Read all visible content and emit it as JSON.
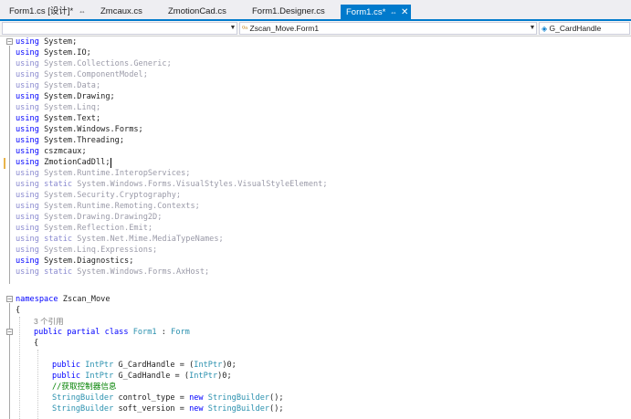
{
  "tabs": [
    {
      "label": "Form1.cs [设计]*",
      "pin": "⇔"
    },
    {
      "label": "Zmcaux.cs"
    },
    {
      "label": "ZmotionCad.cs"
    },
    {
      "label": "Form1.Designer.cs"
    },
    {
      "label": "Form1.cs*",
      "pin": "⇔",
      "close": "✕"
    }
  ],
  "navbar": {
    "scope_value": "",
    "class_value": "Zscan_Move.Form1",
    "member_value": "G_CardHandle",
    "class_icon": "class-icon",
    "member_icon": "field-icon"
  },
  "code": {
    "using_lines": [
      "System;",
      "System.IO;",
      "System.Collections.Generic;",
      "System.ComponentModel;",
      "System.Data;",
      "System.Drawing;",
      "System.Linq;",
      "System.Text;",
      "System.Windows.Forms;",
      "System.Threading;",
      "cszmcaux;",
      "ZmotionCadDll;",
      "System.Runtime.InteropServices;",
      "System.Windows.Forms.VisualStyles.VisualStyleElement;",
      "System.Security.Cryptography;",
      "System.Runtime.Remoting.Contexts;",
      "System.Drawing.Drawing2D;",
      "System.Reflection.Emit;",
      "System.Net.Mime.MediaTypeNames;",
      "System.Linq.Expressions;",
      "System.Diagnostics;",
      "System.Windows.Forms.AxHost;"
    ],
    "kw_using": "using",
    "kw_static": "static",
    "kw_namespace": "namespace",
    "namespace_name": "Zscan_Move",
    "open_brace": "{",
    "ref_count": "3 个引用",
    "kw_public": "public",
    "kw_partial": "partial",
    "kw_class": "class",
    "class_name": "Form1",
    "colon": ":",
    "base_class": "Form",
    "intptr": "IntPtr",
    "field1": "G_CardHandle = (",
    "field2": "G_CadHandle = (",
    "zero_end": ")0;",
    "comment": "//获取控制器信息",
    "sb_type": "StringBuilder",
    "sb1": "control_type = ",
    "sb2": "soft_version = ",
    "kw_new": "new",
    "sb_end": "();"
  }
}
